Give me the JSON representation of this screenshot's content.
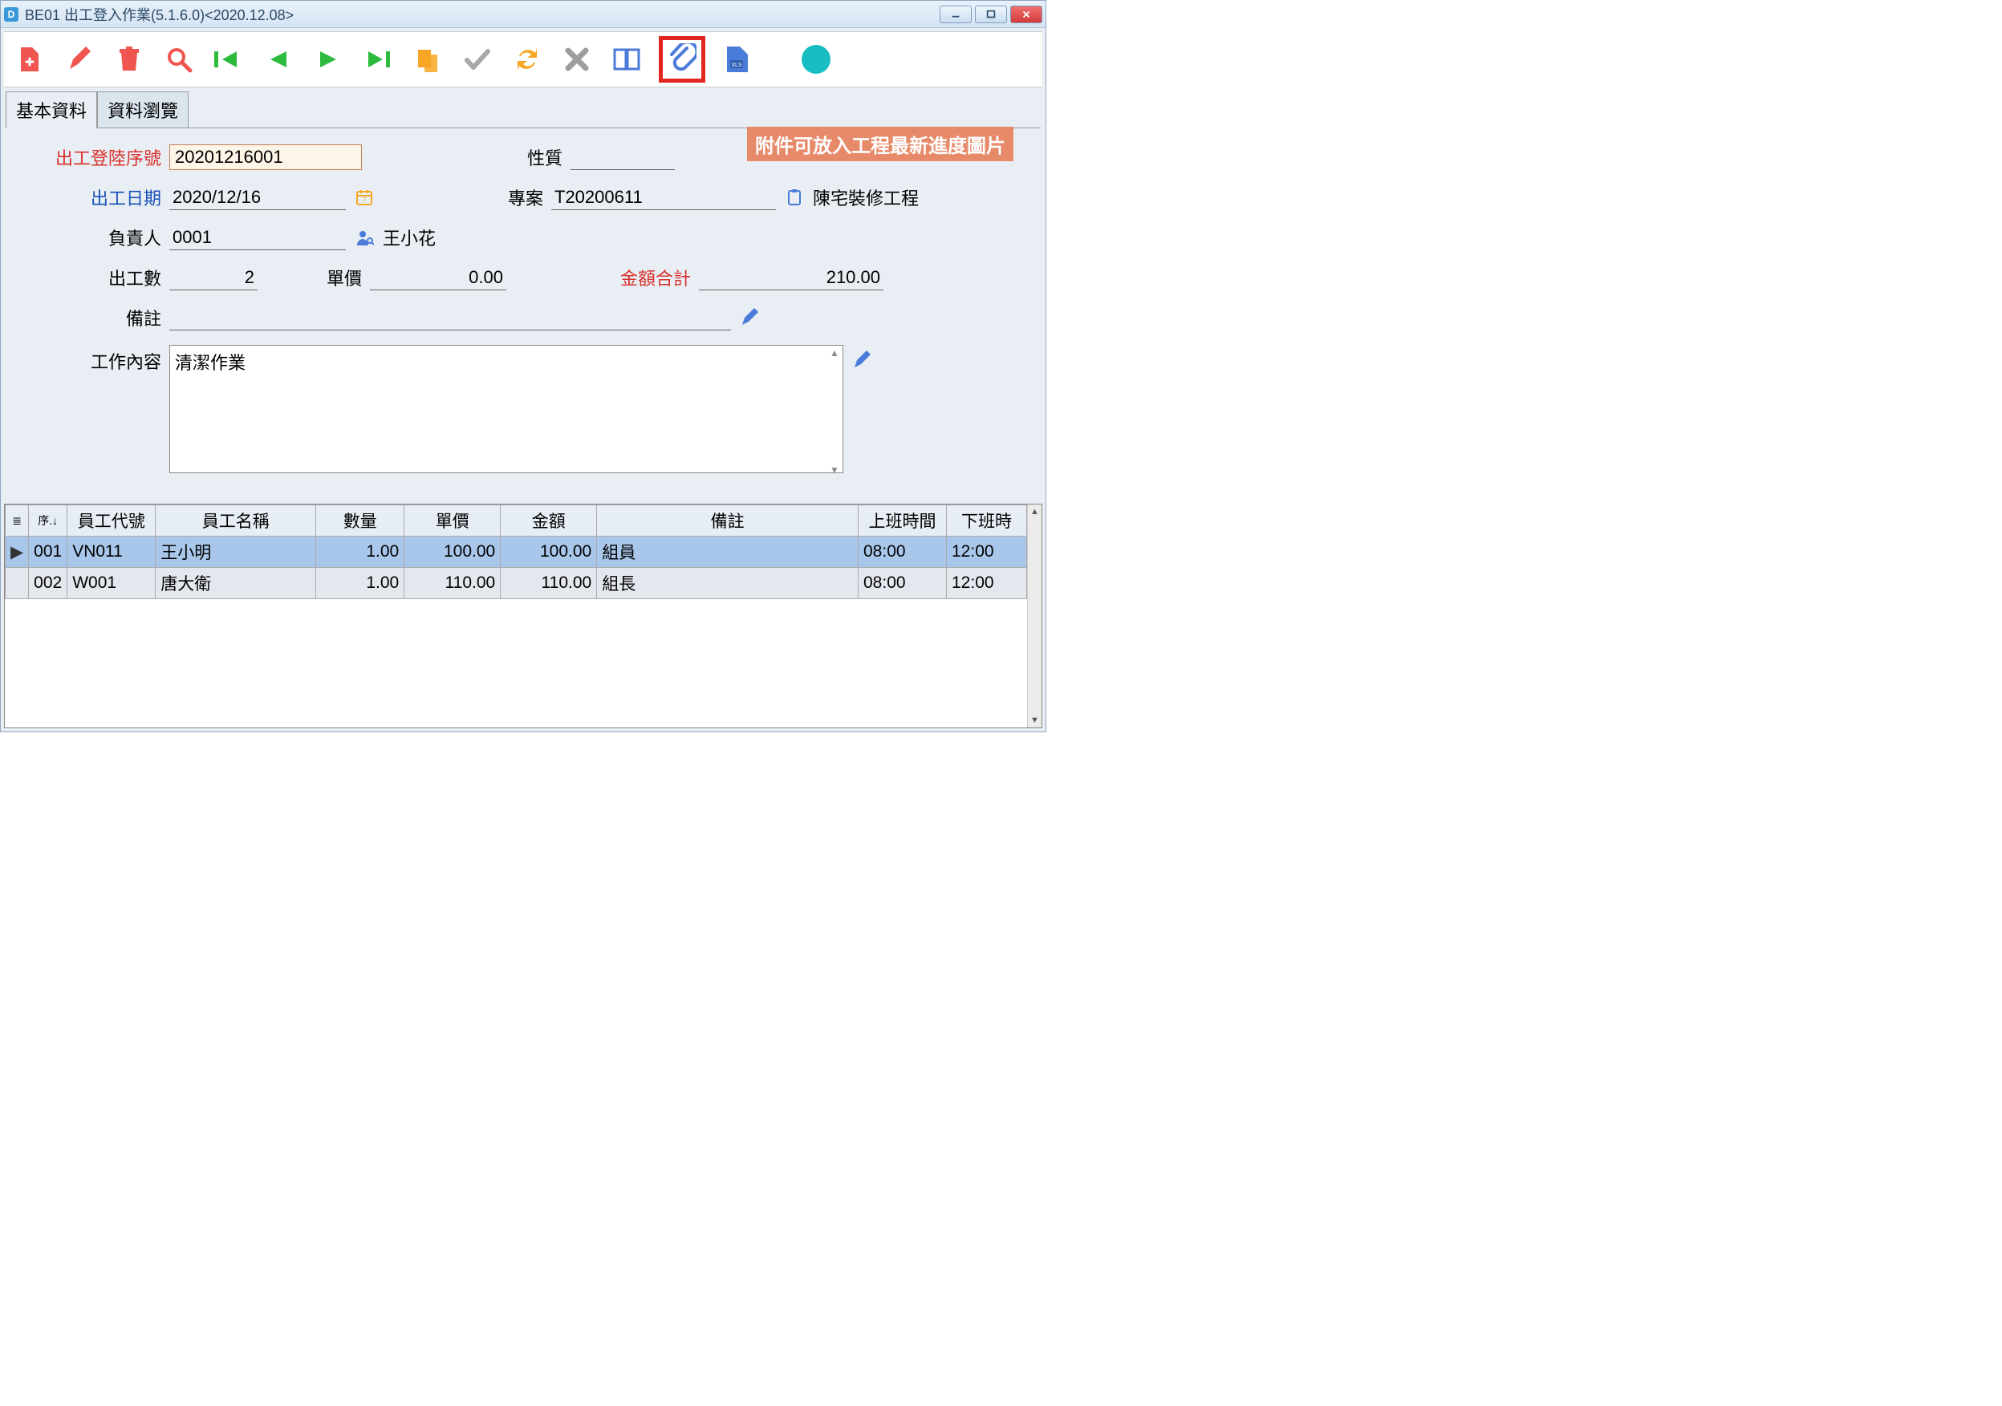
{
  "window": {
    "title": "BE01 出工登入作業(5.1.6.0)<2020.12.08>"
  },
  "tabs": {
    "basic": "基本資料",
    "browse": "資料瀏覽"
  },
  "annotation": "附件可放入工程最新進度圖片",
  "form": {
    "seq_label": "出工登陸序號",
    "seq_value": "20201216001",
    "nature_label": "性質",
    "nature_value": "",
    "date_label": "出工日期",
    "date_value": "2020/12/16",
    "project_label": "專案",
    "project_value": "T20200611",
    "project_name": "陳宅裝修工程",
    "owner_label": "負責人",
    "owner_value": "0001",
    "owner_name": "王小花",
    "count_label": "出工數",
    "count_value": "2",
    "price_label": "單價",
    "price_value": "0.00",
    "total_label": "金額合計",
    "total_value": "210.00",
    "remark_label": "備註",
    "remark_value": "",
    "content_label": "工作內容",
    "content_value": "清潔作業"
  },
  "grid": {
    "headers": {
      "mini1": "序.",
      "mini2": "↓",
      "emp_id": "員工代號",
      "emp_name": "員工名稱",
      "qty": "數量",
      "price": "單價",
      "amount": "金額",
      "remark": "備註",
      "on_time": "上班時間",
      "off_time": "下班時"
    },
    "rows": [
      {
        "ptr": "▶",
        "seq": "001",
        "emp_id": "VN011",
        "emp_name": "王小明",
        "qty": "1.00",
        "price": "100.00",
        "amount": "100.00",
        "remark": "組員",
        "on_time": "08:00",
        "off_time": "12:00"
      },
      {
        "ptr": "",
        "seq": "002",
        "emp_id": "W001",
        "emp_name": "唐大衛",
        "qty": "1.00",
        "price": "110.00",
        "amount": "110.00",
        "remark": "組長",
        "on_time": "08:00",
        "off_time": "12:00"
      }
    ]
  }
}
